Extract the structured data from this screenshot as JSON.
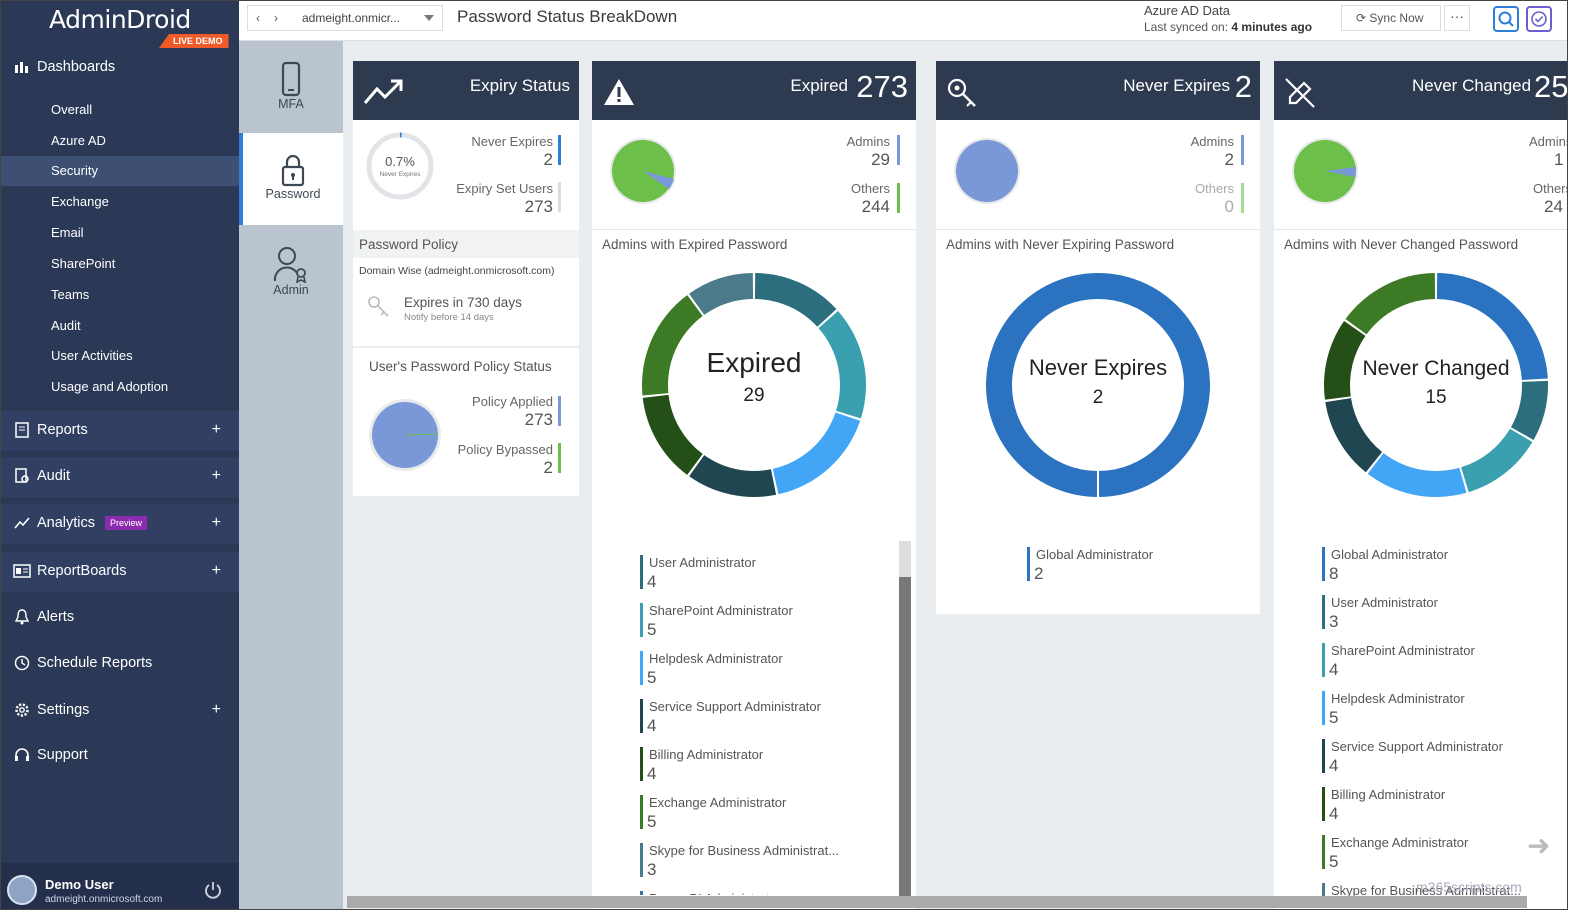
{
  "app": {
    "logo": "AdminDroid",
    "badge": "LIVE DEMO"
  },
  "topbar": {
    "tenant": "admeight.onmicr...",
    "page_title": "Password Status BreakDown",
    "azure_title": "Azure AD Data",
    "sync_label": "Last synced on:",
    "sync_time": "4 minutes ago",
    "sync_button": "Sync Now",
    "more": "···"
  },
  "sidebar": {
    "dashboards": "Dashboards",
    "dash_items": [
      "Overall",
      "Azure AD",
      "Security",
      "Exchange",
      "Email",
      "SharePoint",
      "Teams",
      "Audit",
      "User Activities",
      "Usage and Adoption"
    ],
    "reports": "Reports",
    "audit": "Audit",
    "analytics": "Analytics",
    "analytics_badge": "Preview",
    "reportboards": "ReportBoards",
    "alerts": "Alerts",
    "schedule": "Schedule Reports",
    "settings": "Settings",
    "support": "Support",
    "plus": "+",
    "user_name": "Demo User",
    "user_email": "admeight.onmicrosoft.com"
  },
  "rail": {
    "mfa": "MFA",
    "password": "Password",
    "admin": "Admin"
  },
  "expiry": {
    "title": "Expiry Status",
    "pct": "0.7%",
    "pct_label": "Never Expires",
    "pct_value": 0.7,
    "never_expires_label": "Never Expires",
    "never_expires_value": "2",
    "expiry_set_label": "Expiry Set Users",
    "expiry_set_value": "273",
    "policy_title": "Password Policy",
    "policy_domain": "Domain Wise (admeight.onmicrosoft.com)",
    "expires_in": "Expires in 730 days",
    "notify": "Notify before 14 days",
    "status_title": "User's Password Policy Status",
    "applied_label": "Policy Applied",
    "applied_value": "273",
    "bypassed_label": "Policy Bypassed",
    "bypassed_value": "2"
  },
  "expired": {
    "title": "Expired",
    "count": "273",
    "admins_label": "Admins",
    "admins_value": "29",
    "others_label": "Others",
    "others_value": "244",
    "section": "Admins with Expired Password",
    "center_title": "Expired",
    "center_value": "29",
    "legend": [
      {
        "name": "User Administrator",
        "value": "4",
        "color": "#2c6e7e"
      },
      {
        "name": "SharePoint Administrator",
        "value": "5",
        "color": "#3aa0b0"
      },
      {
        "name": "Helpdesk Administrator",
        "value": "5",
        "color": "#42a5f5"
      },
      {
        "name": "Service Support Administrator",
        "value": "4",
        "color": "#1f4651"
      },
      {
        "name": "Billing Administrator",
        "value": "4",
        "color": "#244f16"
      },
      {
        "name": "Exchange Administrator",
        "value": "5",
        "color": "#3d7a25"
      },
      {
        "name": "Skype for Business Administrat...",
        "value": "3",
        "color": "#4b7a8a"
      },
      {
        "name": "Power BI Administrator",
        "value": "",
        "color": "#3a6f9f"
      }
    ]
  },
  "never_expires": {
    "title": "Never Expires",
    "count": "2",
    "admins_label": "Admins",
    "admins_value": "2",
    "others_label": "Others",
    "others_value": "0",
    "section": "Admins with Never Expiring Password",
    "center_title": "Never Expires",
    "center_value": "2",
    "legend": [
      {
        "name": "Global Administrator",
        "value": "2",
        "color": "#2b73c0"
      }
    ]
  },
  "never_changed": {
    "title": "Never Changed",
    "count": "25",
    "admins_label": "Admins",
    "admins_value": "1",
    "others_label": "Others",
    "others_value": "24",
    "section": "Admins with Never Changed Password",
    "center_title": "Never Changed",
    "center_value": "15",
    "legend": [
      {
        "name": "Global Administrator",
        "value": "8",
        "color": "#2b73c0"
      },
      {
        "name": "User Administrator",
        "value": "3",
        "color": "#2c6e7e"
      },
      {
        "name": "SharePoint Administrator",
        "value": "4",
        "color": "#3aa0b0"
      },
      {
        "name": "Helpdesk Administrator",
        "value": "5",
        "color": "#42a5f5"
      },
      {
        "name": "Service Support Administrator",
        "value": "4",
        "color": "#1f4651"
      },
      {
        "name": "Billing Administrator",
        "value": "4",
        "color": "#244f16"
      },
      {
        "name": "Exchange Administrator",
        "value": "5",
        "color": "#3d7a25"
      },
      {
        "name": "Skype for Business Administrat...",
        "value": "",
        "color": "#4b7a8a"
      }
    ]
  },
  "watermark": "m365scripts.com",
  "colors": {
    "accent": "#2d7fd8",
    "sidebar": "#2b3856",
    "header": "#2e3a50",
    "orange": "#f05a28",
    "green": "#6cc04a",
    "pie_blue": "#7a97d8"
  }
}
